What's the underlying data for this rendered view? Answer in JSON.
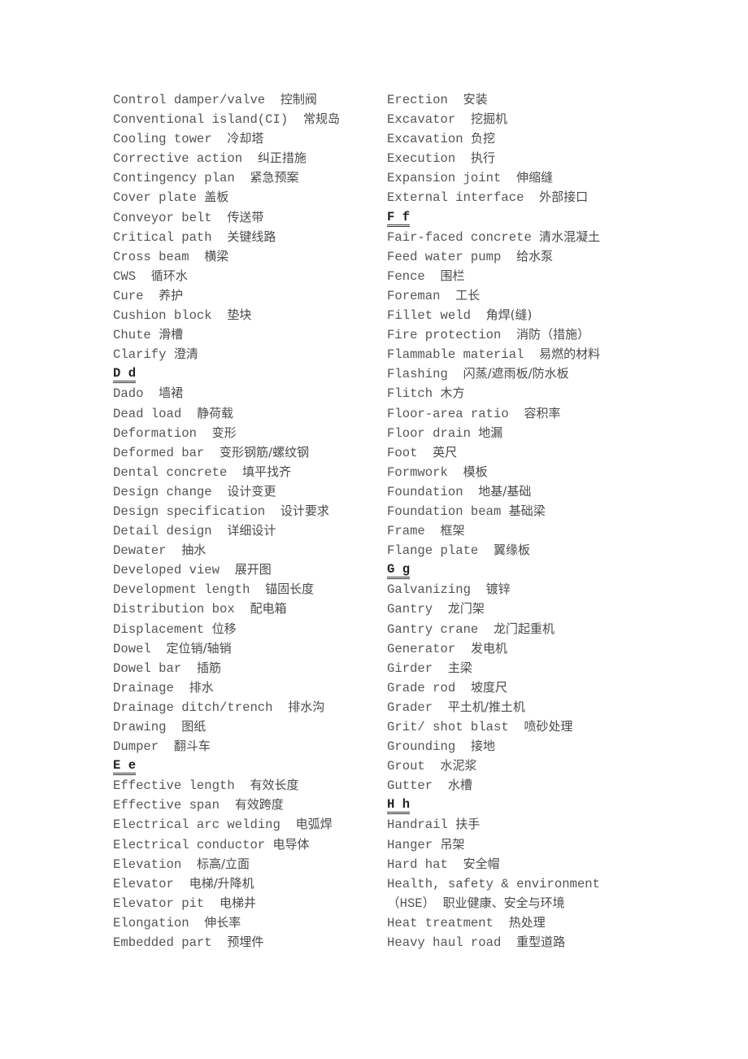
{
  "left_column": [
    {
      "en": "Control damper/valve  ",
      "zh": "控制阀"
    },
    {
      "en": "Conventional island(CI)  ",
      "zh": "常规岛"
    },
    {
      "en": "Cooling tower  ",
      "zh": "冷却塔"
    },
    {
      "en": "Corrective action  ",
      "zh": "纠正措施"
    },
    {
      "en": "Contingency plan  ",
      "zh": "紧急预案"
    },
    {
      "en": "Cover plate ",
      "zh": "盖板"
    },
    {
      "en": "Conveyor belt  ",
      "zh": "传送带"
    },
    {
      "en": "Critical path  ",
      "zh": "关键线路"
    },
    {
      "en": "Cross beam  ",
      "zh": "横梁"
    },
    {
      "en": "CWS  ",
      "zh": "循环水"
    },
    {
      "en": "Cure  ",
      "zh": "养护"
    },
    {
      "en": "Cushion block  ",
      "zh": "垫块"
    },
    {
      "en": "Chute ",
      "zh": "滑槽"
    },
    {
      "en": "Clarify ",
      "zh": "澄清"
    },
    {
      "heading": "D d"
    },
    {
      "en": "Dado  ",
      "zh": "墙裙"
    },
    {
      "en": "Dead load  ",
      "zh": "静荷载"
    },
    {
      "en": "Deformation  ",
      "zh": "变形"
    },
    {
      "en": "Deformed bar  ",
      "zh": "变形钢筋/螺纹钢"
    },
    {
      "en": "Dental concrete  ",
      "zh": "填平找齐"
    },
    {
      "en": "Design change  ",
      "zh": "设计变更"
    },
    {
      "en": "Design specification  ",
      "zh": "设计要求"
    },
    {
      "en": "Detail design  ",
      "zh": "详细设计"
    },
    {
      "en": "Dewater  ",
      "zh": "抽水"
    },
    {
      "en": "Developed view  ",
      "zh": "展开图"
    },
    {
      "en": "Development length  ",
      "zh": "锚固长度"
    },
    {
      "en": "Distribution box  ",
      "zh": "配电箱"
    },
    {
      "en": "Displacement ",
      "zh": "位移"
    },
    {
      "en": "Dowel  ",
      "zh": "定位销/轴销"
    },
    {
      "en": "Dowel bar  ",
      "zh": "插筋"
    },
    {
      "en": "Drainage  ",
      "zh": "排水"
    },
    {
      "en": "Drainage ditch/trench  ",
      "zh": "排水沟"
    },
    {
      "en": "Drawing  ",
      "zh": "图纸"
    },
    {
      "en": "Dumper  ",
      "zh": "翻斗车"
    },
    {
      "heading": "E e"
    },
    {
      "en": "Effective length  ",
      "zh": "有效长度"
    },
    {
      "en": "Effective span  ",
      "zh": "有效跨度"
    },
    {
      "en": "Electrical arc welding  ",
      "zh": "电弧焊"
    },
    {
      "en": "Electrical conductor ",
      "zh": "电导体"
    },
    {
      "en": "Elevation  ",
      "zh": "标高/立面"
    },
    {
      "en": "Elevator  ",
      "zh": "电梯/升降机"
    },
    {
      "en": "Elevator pit  ",
      "zh": "电梯井"
    },
    {
      "en": "Elongation  ",
      "zh": "伸长率"
    },
    {
      "en": "Embedded part  ",
      "zh": "预埋件"
    }
  ],
  "right_column": [
    {
      "en": "Erection  ",
      "zh": "安装"
    },
    {
      "en": "Excavator  ",
      "zh": "挖掘机"
    },
    {
      "en": "Excavation ",
      "zh": "负挖"
    },
    {
      "en": "Execution  ",
      "zh": "执行"
    },
    {
      "en": "Expansion joint  ",
      "zh": "伸缩缝"
    },
    {
      "en": "External interface  ",
      "zh": "外部接口"
    },
    {
      "heading": "F f"
    },
    {
      "en": "Fair-faced concrete ",
      "zh": "清水混凝土"
    },
    {
      "en": "Feed water pump  ",
      "zh": "给水泵"
    },
    {
      "en": "Fence  ",
      "zh": "围栏"
    },
    {
      "en": "Foreman  ",
      "zh": "工长"
    },
    {
      "en": "Fillet weld  ",
      "zh": "角焊(缝)"
    },
    {
      "en": "Fire protection  ",
      "zh": "消防（措施）"
    },
    {
      "en": "Flammable material  ",
      "zh": "易燃的材料"
    },
    {
      "en": "Flashing  ",
      "zh": "闪蒸/遮雨板/防水板"
    },
    {
      "en": "Flitch ",
      "zh": "木方"
    },
    {
      "en": "Floor-area ratio  ",
      "zh": "容积率"
    },
    {
      "en": "Floor drain ",
      "zh": "地漏"
    },
    {
      "en": "Foot  ",
      "zh": "英尺"
    },
    {
      "en": "Formwork  ",
      "zh": "模板"
    },
    {
      "en": "Foundation  ",
      "zh": "地基/基础"
    },
    {
      "en": "Foundation beam ",
      "zh": "基础梁"
    },
    {
      "en": "Frame  ",
      "zh": "框架"
    },
    {
      "en": "Flange plate  ",
      "zh": "翼缘板"
    },
    {
      "heading": "G g"
    },
    {
      "en": "Galvanizing  ",
      "zh": "镀锌"
    },
    {
      "en": "Gantry  ",
      "zh": "龙门架"
    },
    {
      "en": "Gantry crane  ",
      "zh": "龙门起重机"
    },
    {
      "en": "Generator  ",
      "zh": "发电机"
    },
    {
      "en": "Girder  ",
      "zh": "主梁"
    },
    {
      "en": "Grade rod  ",
      "zh": "坡度尺"
    },
    {
      "en": "Grader  ",
      "zh": "平土机/推土机"
    },
    {
      "en": "Grit/ shot blast  ",
      "zh": "喷砂处理"
    },
    {
      "en": "Grounding  ",
      "zh": "接地"
    },
    {
      "en": "Grout  ",
      "zh": "水泥浆"
    },
    {
      "en": "Gutter  ",
      "zh": "水槽"
    },
    {
      "heading": "H h"
    },
    {
      "en": "Handrail ",
      "zh": "扶手"
    },
    {
      "en": "Hanger ",
      "zh": "吊架"
    },
    {
      "en": "Hard hat  ",
      "zh": "安全帽"
    },
    {
      "en": "Health, safety & environment",
      "zh": ""
    },
    {
      "en": "（HSE） ",
      "zh": "职业健康、安全与环境"
    },
    {
      "en": "Heat treatment  ",
      "zh": "热处理"
    },
    {
      "en": "Heavy haul road  ",
      "zh": "重型道路"
    }
  ]
}
